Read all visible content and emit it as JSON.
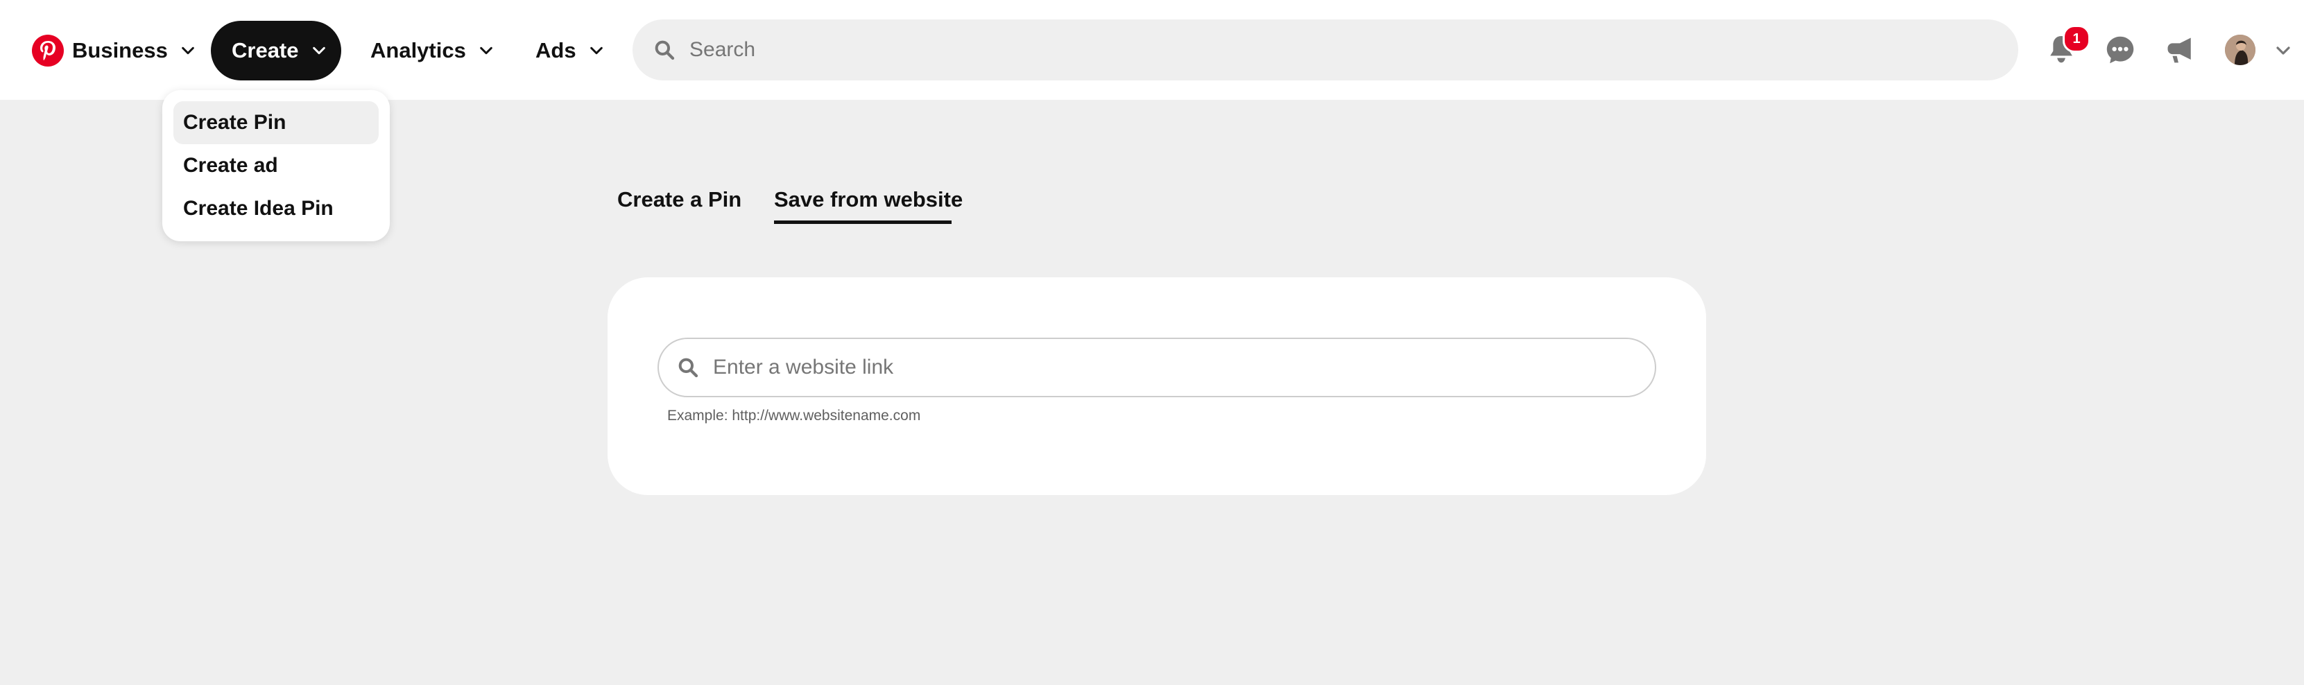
{
  "header": {
    "brand_label": "Business",
    "nav": {
      "create_label": "Create",
      "analytics_label": "Analytics",
      "ads_label": "Ads"
    },
    "search": {
      "placeholder": "Search"
    },
    "notifications_count": "1",
    "accent_color": "#e60023"
  },
  "create_menu": {
    "items": [
      {
        "label": "Create Pin"
      },
      {
        "label": "Create ad"
      },
      {
        "label": "Create Idea Pin"
      }
    ]
  },
  "tabs": [
    {
      "label": "Create a Pin"
    },
    {
      "label": "Save from website"
    }
  ],
  "save_from_website": {
    "input_placeholder": "Enter a website link",
    "example_text": "Example: http://www.websitename.com"
  }
}
